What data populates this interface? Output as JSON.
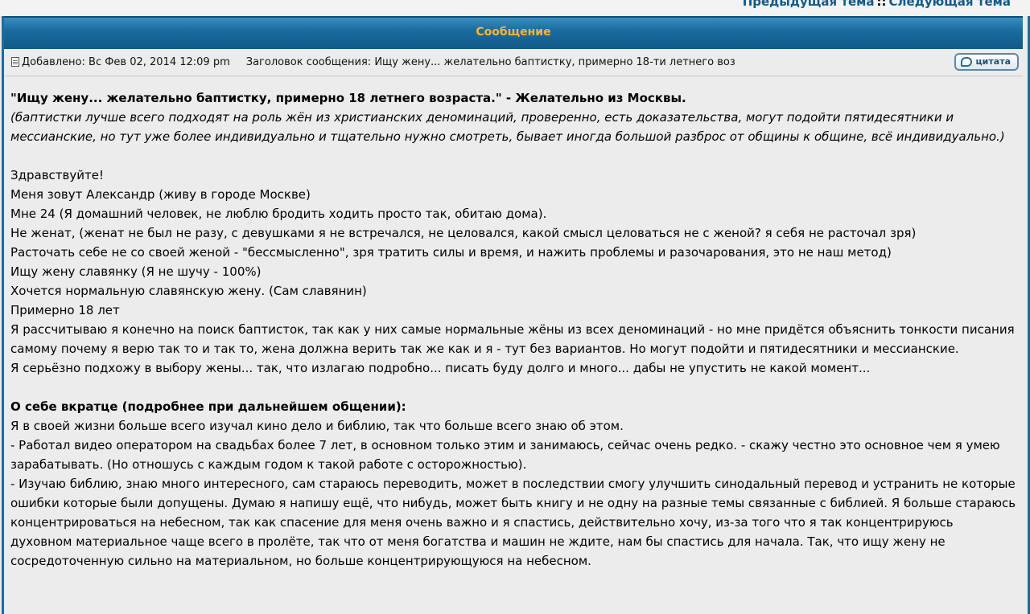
{
  "nav": {
    "prev_topic": "Предыдущая тема",
    "separator": "::",
    "next_topic": "Следующая тема"
  },
  "header": {
    "title": "Сообщение"
  },
  "post_meta": {
    "added": "Добавлено: Вс Фев 02, 2014 12:09 pm",
    "subject_label": "Заголовок сообщения:",
    "subject": "Ищу жену... желательно баптистку, примерно 18-ти летнего воз",
    "quote_button": "цитата"
  },
  "post": {
    "heading": "\"Ищу жену... желательно баптистку, примерно 18 летнего возраста.\" - Желательно из Москвы.",
    "note": "(баптистки лучше всего подходят на роль жён из христианских деноминаций, проверенно, есть доказательства, могут подойти пятидесятники и мессианские, но тут уже более индивидуально и тщательно нужно смотреть, бывает иногда большой разброс от общины к общине, всё индивидуально.)",
    "lines": [
      "Здравствуйте!",
      "Меня зовут Александр (живу в городе Москве)",
      "Мне 24 (Я домашний человек, не люблю бродить ходить просто так, обитаю дома).",
      "Не женат, (женат не был не разу, с девушками я не встречался, не целовался, какой смысл целоваться не с женой? я себя не расточал зря)",
      "Расточать себе не со своей женой - \"бессмысленно\", зря тратить силы и время, и нажить проблемы и разочарования, это не наш метод)",
      "Ищу жену славянку (Я не шучу - 100%)",
      "Хочется нормальную славянскую жену. (Сам славянин)",
      "Примерно 18 лет",
      "Я рассчитываю я конечно на поиск баптисток, так как у них самые нормальные жёны из всех деноминаций - но мне придётся объяснить тонкости писания самому почему я верю так то и так то, жена должна верить так же как и я - тут без вариантов. Но могут подойти и пятидесятники и мессианские.",
      "Я серьёзно подхожу в выбору жены... так, что излагаю подробно... писать буду долго и много... дабы не упустить не какой момент..."
    ],
    "about_heading": "О себе вкратце (подробнее при дальнейшем общении):",
    "about_lines": [
      "Я в своей жизни больше всего изучал кино дело и библию, так что больше всего знаю об этом.",
      "- Работал видео оператором на свадьбах более 7 лет, в основном только этим и занимаюсь, сейчас очень редко. - скажу честно это основное чем я умею зарабатывать. (Но отношусь с каждым годом к такой работе с осторожностью).",
      "- Изучаю библию, знаю много интересного, сам стараюсь переводить, может в последствии смогу улучшить синодальный перевод и устранить не которые ошибки которые были допущены. Думаю я напишу ещё, что нибудь, может быть книгу и не одну на разные темы связанные с библией. Я больше стараюсь концентрироваться на небесном, так как спасение для меня очень важно и я спастись, действительно хочу, из-за того что я так концентрируюсь духовном материальное чаще всего в пролёте, так что от меня богатства и машин не ждите, нам бы спастись для начала. Так, что ищу жену не сосредоточенную сильно на материальном, но больше концентрирующуюся на небесном."
    ]
  },
  "colors": {
    "header_bg": "#1a6c9f",
    "header_text": "#ffb43c",
    "nav_link": "#0f5b8a",
    "page_bg": "#ececec"
  }
}
